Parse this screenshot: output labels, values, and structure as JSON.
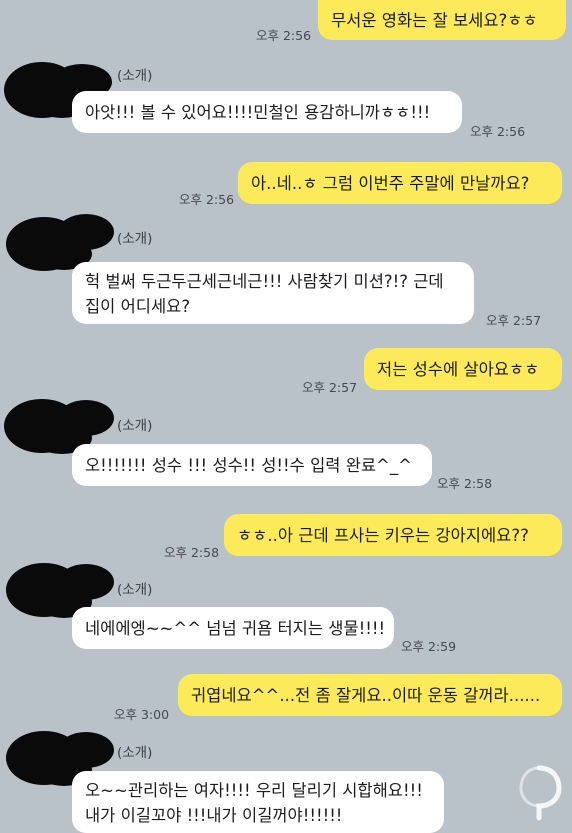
{
  "chat": {
    "messages": [
      {
        "side": "me",
        "text": "무서운 영화는 잘 보세요?ㅎㅎ",
        "time": "오후 2:56"
      },
      {
        "side": "other",
        "sender": "(소개)",
        "text": "아앗!!! 볼 수 있어요!!!!민철인 용감하니까ㅎㅎ!!!",
        "time": "오후 2:56"
      },
      {
        "side": "me",
        "text": "아..네..ㅎ 그럼 이번주 주말에 만날까요?",
        "time": "오후 2:56"
      },
      {
        "side": "other",
        "sender": "(소개)",
        "lines": [
          "헉 벌써 두근두근세근네근!!! 사람찾기 미션?!? 근데",
          "집이 어디세요?"
        ],
        "time": "오후 2:57"
      },
      {
        "side": "me",
        "text": "저는 성수에 살아요ㅎㅎ",
        "time": "오후 2:57"
      },
      {
        "side": "other",
        "sender": "(소개)",
        "text": "오!!!!!!! 성수 !!! 성수!! 성!!수 입력 완료^_^",
        "time": "오후 2:58"
      },
      {
        "side": "me",
        "text": "ㅎㅎ..아 근데 프사는 키우는 강아지에요??",
        "time": "오후 2:58"
      },
      {
        "side": "other",
        "sender": "(소개)",
        "text": "네에에엥~~^^ 넘넘 귀욤 터지는 생물!!!!",
        "time": "오후 2:59"
      },
      {
        "side": "me",
        "text": "귀엽네요^^...전 좀 잘게요..이따 운동 갈꺼라......",
        "time": "오후 3:00"
      },
      {
        "side": "other",
        "sender": "(소개)",
        "lines": [
          "오~~관리하는 여자!!!! 우리 달리기 시합해요!!!",
          "내가 이길꼬야 !!!내가 이길꺼야!!!!!!"
        ]
      }
    ]
  },
  "colors": {
    "background": "#b9c1c9",
    "my_bubble": "#fdea5a",
    "other_bubble": "#ffffff",
    "censor": "#0a0a0a"
  },
  "icons": {
    "avatar": "censored-avatar-blob",
    "watermark": "logo-watermark"
  }
}
